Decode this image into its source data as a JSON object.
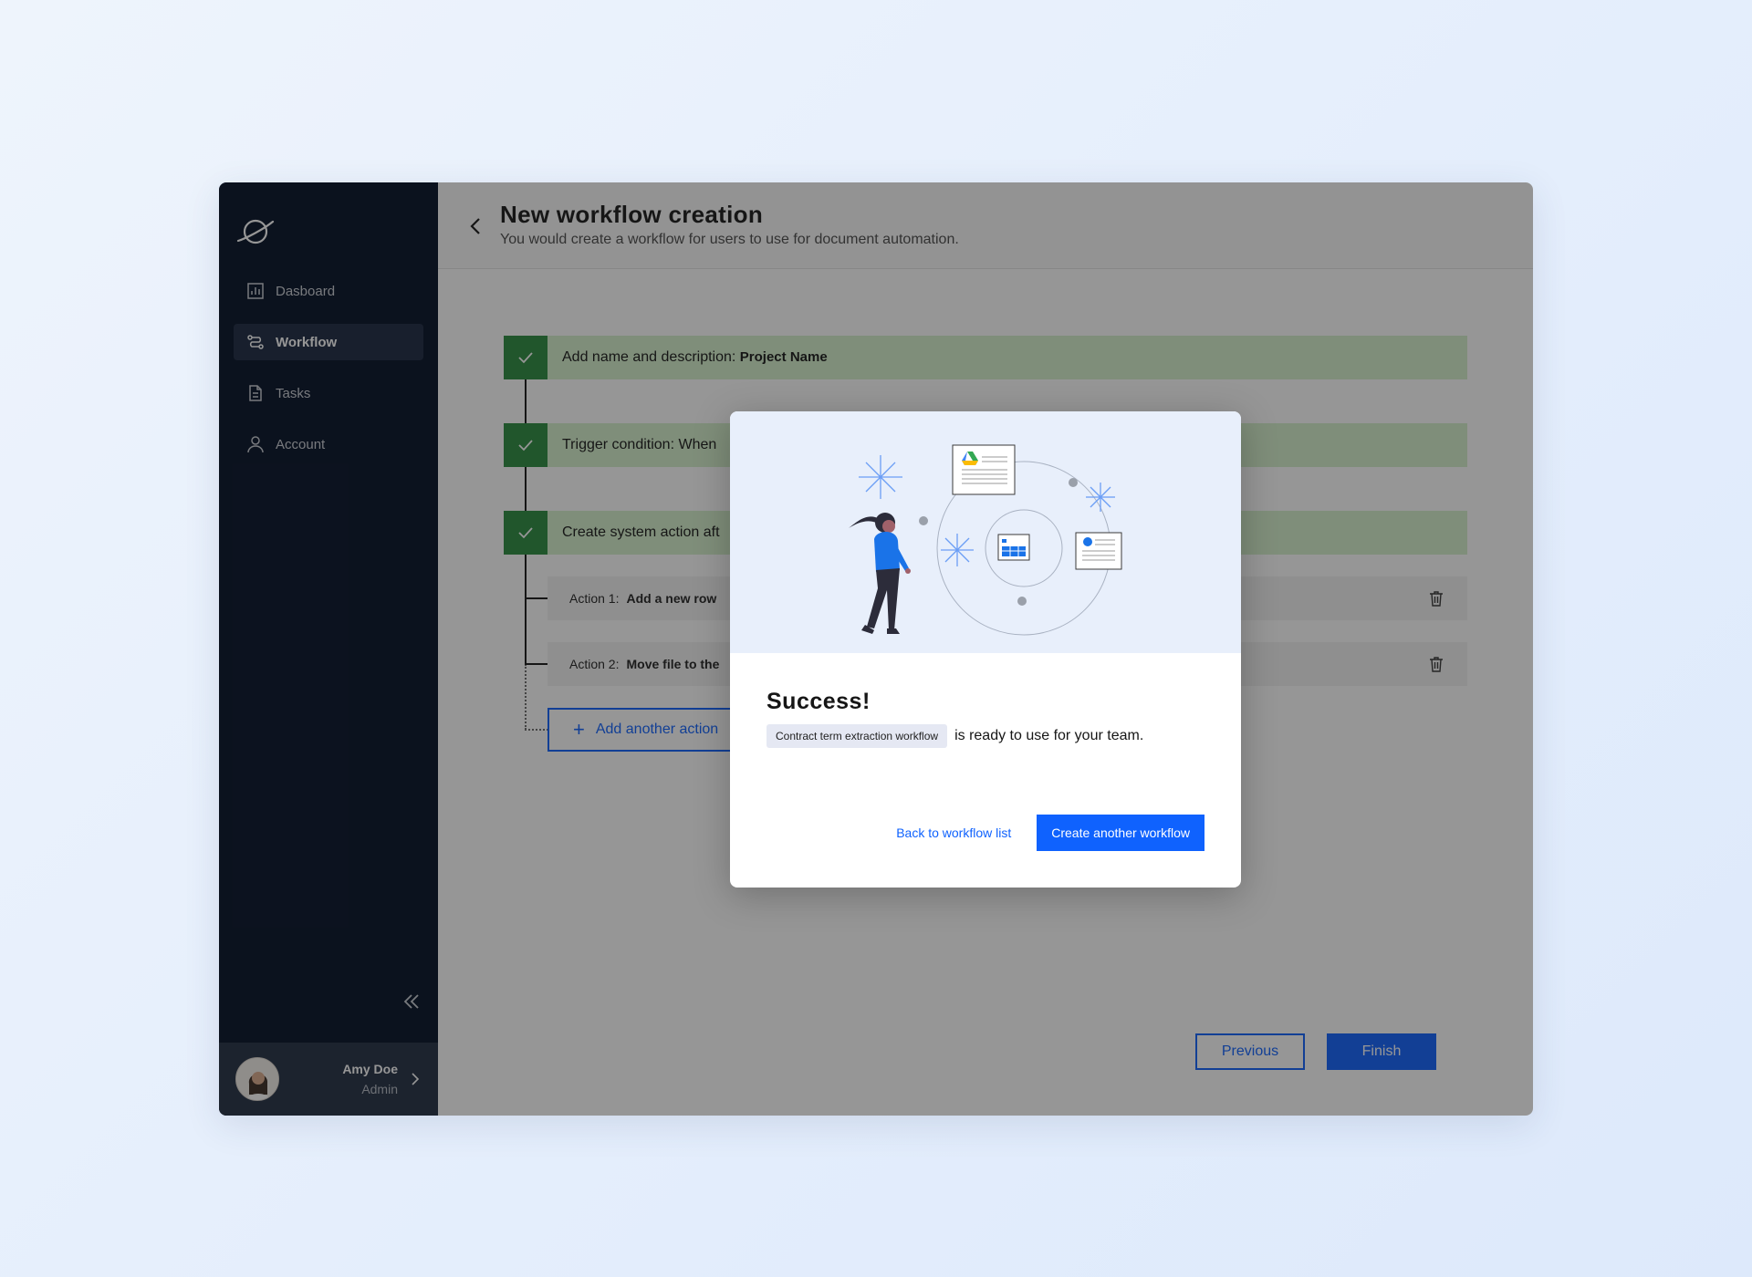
{
  "sidebar": {
    "items": [
      {
        "label": "Dasboard",
        "icon": "chart-icon"
      },
      {
        "label": "Workflow",
        "icon": "workflow-icon",
        "active": true
      },
      {
        "label": "Tasks",
        "icon": "document-icon"
      },
      {
        "label": "Account",
        "icon": "user-icon"
      }
    ],
    "user": {
      "name": "Amy Doe",
      "role": "Admin"
    }
  },
  "header": {
    "title": "New workflow creation",
    "subtitle": "You would create a workflow for users to use for document automation."
  },
  "steps": [
    {
      "prefix": "Add name and description:",
      "value": "Project Name"
    },
    {
      "prefix": "Trigger condition: When",
      "value": ""
    },
    {
      "prefix": "Create system action aft",
      "value": ""
    }
  ],
  "actions": [
    {
      "prefix": "Action 1:",
      "value": "Add a new row"
    },
    {
      "prefix": "Action 2:",
      "value": "Move file to the"
    }
  ],
  "add_action_label": "Add another action",
  "footer": {
    "previous": "Previous",
    "finish": "Finish"
  },
  "modal": {
    "title": "Success!",
    "tag": "Contract term extraction workflow",
    "message": "is ready to use for your team.",
    "secondary": "Back to workflow list",
    "primary": "Create another workflow"
  },
  "colors": {
    "sidebar_bg": "#030f26",
    "accent": "#0f62fe",
    "success": "#2a8a3e",
    "step_bg": "#d6f1cc"
  }
}
